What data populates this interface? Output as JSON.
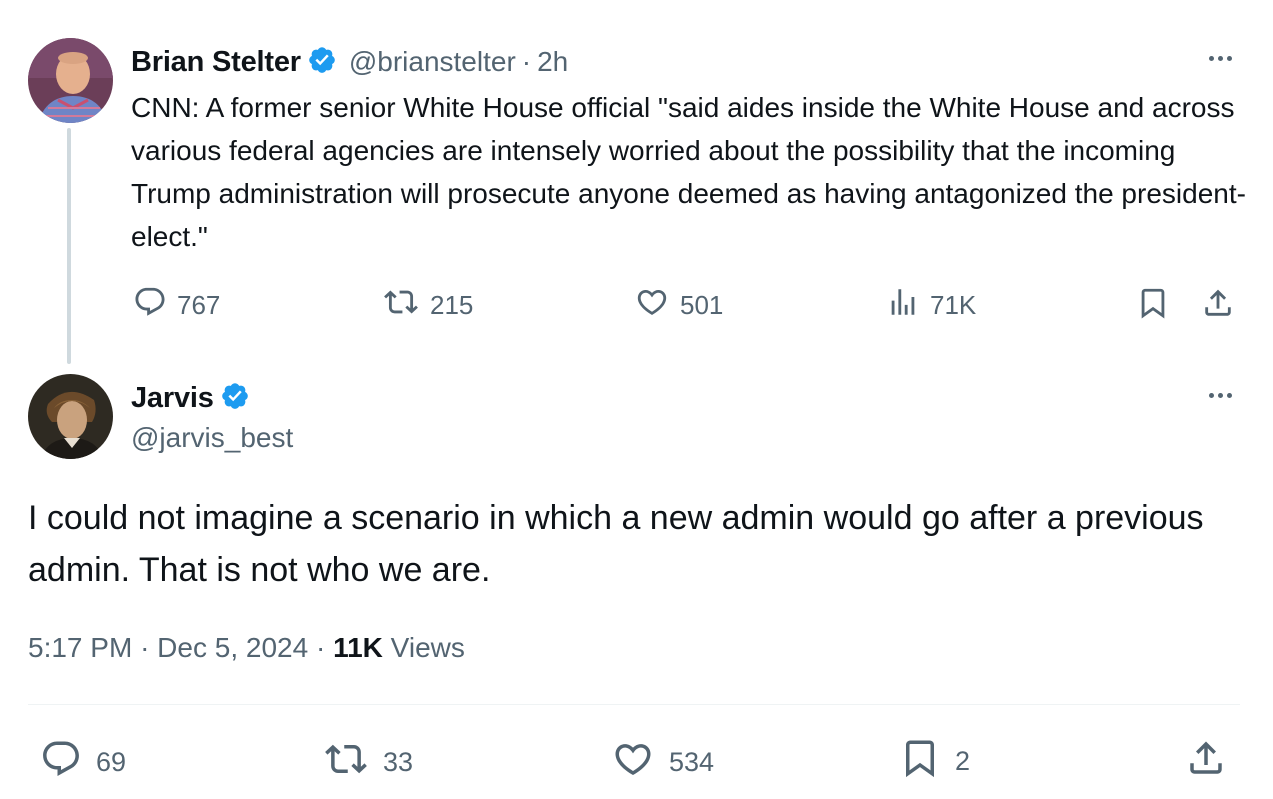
{
  "quoted_tweet": {
    "author_name": "Brian Stelter",
    "author_handle": "@brianstelter",
    "separator": "·",
    "time": "2h",
    "text": "CNN: A former senior White House official \"said aides inside the White House and across various federal agencies are intensely worried about the possibility that the incoming Trump administration will prosecute anyone deemed as having antagonized the president-elect.\"",
    "replies": "767",
    "reposts": "215",
    "likes": "501",
    "views": "71K",
    "verified": true
  },
  "main_tweet": {
    "author_name": "Jarvis",
    "author_handle": "@jarvis_best",
    "verified": true,
    "text": "I could not imagine a scenario in which a new admin would go after a previous admin. That is not who we are.",
    "time": "5:17 PM",
    "sep1": "·",
    "date": "Dec 5, 2024",
    "sep2": "·",
    "views_count": "11K",
    "views_label": "Views",
    "replies": "69",
    "reposts": "33",
    "likes": "534",
    "bookmarks": "2"
  },
  "colors": {
    "verified_blue": "#1d9bf0",
    "secondary_text": "#536471",
    "primary_text": "#0f1419",
    "thread_line": "#cfd9de"
  },
  "icons": [
    "verified-badge-icon",
    "more-icon",
    "reply-icon",
    "repost-icon",
    "like-icon",
    "views-icon",
    "bookmark-icon",
    "share-icon"
  ]
}
